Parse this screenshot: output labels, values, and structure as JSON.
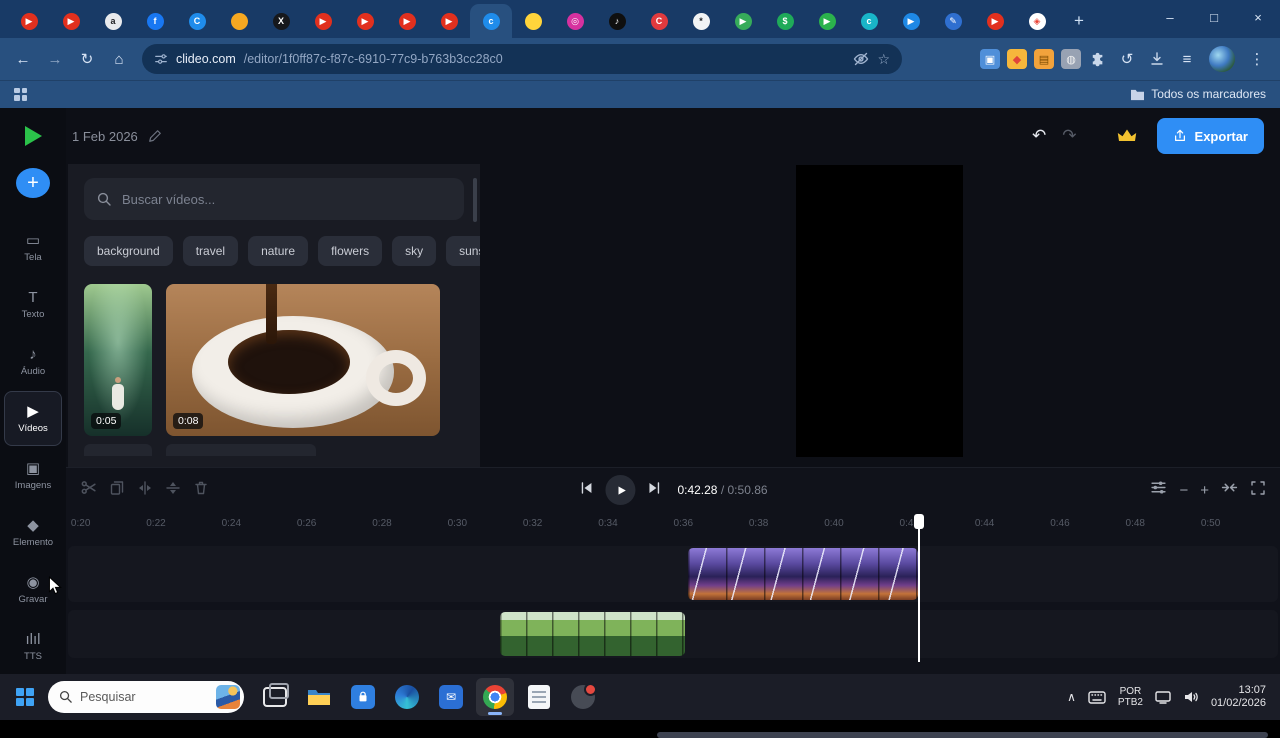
{
  "theme": {
    "accent": "#2f8ef5",
    "crown": "#f2c230",
    "logo-green": "#2bc24a",
    "chrome-bar": "#28507f",
    "chrome-dark": "#183a66",
    "chrome-pill": "#133256",
    "app-bg": "#0d0f16",
    "panel-bg": "#191b23",
    "taskbar-bg": "#1b1d27"
  },
  "icons": {
    "back": "←",
    "forward": "→",
    "reload": "↻",
    "home": "⌂",
    "star": "☆",
    "history": "↺",
    "reading_list": "≡",
    "menu": "⋮",
    "minimize": "–",
    "maximize": "□",
    "close": "×",
    "new_tab": "+",
    "add": "+",
    "undo": "↶",
    "redo": "↷",
    "zoom_out": "−",
    "zoom_in": "+",
    "chevron_up": "∧",
    "envelope": "✉"
  },
  "browser": {
    "tabs": [
      {
        "name": "youtube",
        "bg": "#e1301e",
        "glyph": "▶"
      },
      {
        "name": "youtube",
        "bg": "#e1301e",
        "glyph": "▶"
      },
      {
        "name": "amazon",
        "bg": "#e8eaed",
        "glyph": "a",
        "fg": "#202124"
      },
      {
        "name": "facebook",
        "bg": "#1877f2",
        "glyph": "f"
      },
      {
        "name": "c-app",
        "bg": "#1f8ceb",
        "glyph": "C"
      },
      {
        "name": "orange-app",
        "bg": "#f6a821",
        "glyph": ""
      },
      {
        "name": "x",
        "bg": "#16181c",
        "glyph": "X"
      },
      {
        "name": "youtube",
        "bg": "#e1301e",
        "glyph": "▶"
      },
      {
        "name": "youtube",
        "bg": "#e1301e",
        "glyph": "▶"
      },
      {
        "name": "youtube",
        "bg": "#e1301e",
        "glyph": "▶"
      },
      {
        "name": "youtube",
        "bg": "#e1301e",
        "glyph": "▶"
      },
      {
        "name": "clideo",
        "bg": "#1f8ceb",
        "glyph": "c",
        "active": true
      },
      {
        "name": "yellow-app",
        "bg": "#ffd43b",
        "glyph": "",
        "fg": "#333333"
      },
      {
        "name": "instagram",
        "bg": "#d6319f",
        "glyph": "◎"
      },
      {
        "name": "tiktok",
        "bg": "#0f0f0f",
        "glyph": "♪"
      },
      {
        "name": "red-c-app",
        "bg": "#e03a3e",
        "glyph": "C"
      },
      {
        "name": "white-app",
        "bg": "#f1f3f4",
        "glyph": "*",
        "fg": "#202124"
      },
      {
        "name": "play-app",
        "bg": "#36ab5a",
        "glyph": "▶"
      },
      {
        "name": "dollar-app",
        "bg": "#1faa59",
        "glyph": "$"
      },
      {
        "name": "green-play-app",
        "bg": "#2bb24c",
        "glyph": "▶"
      },
      {
        "name": "teal-c-app",
        "bg": "#19b5c8",
        "glyph": "c"
      },
      {
        "name": "blue-play-app",
        "bg": "#1e88e5",
        "glyph": "▶"
      },
      {
        "name": "pen-app",
        "bg": "#2f6fd0",
        "glyph": "✎"
      },
      {
        "name": "youtube",
        "bg": "#e1301e",
        "glyph": "▶"
      },
      {
        "name": "photos-app",
        "bg": "#ffffff",
        "glyph": "◈",
        "fg": "#ea4335"
      }
    ],
    "address": {
      "host": "clideo.com",
      "path": "/editor/1f0ff87c-f87c-6910-77c9-b763b3cc28c0"
    },
    "ext_icons": [
      {
        "name": "image-extension",
        "bg": "#4f8fd9",
        "glyph": "▣"
      },
      {
        "name": "colorful-extension",
        "bg": "#f6b73c",
        "glyph": "◆",
        "fg": "#e0453a"
      },
      {
        "name": "folder-extension",
        "bg": "#f2a33c",
        "glyph": "▤",
        "fg": "#7a4a00"
      },
      {
        "name": "globe-extension",
        "bg": "#98a2b3",
        "glyph": "◍",
        "fg": "#f0f0f0"
      }
    ],
    "bookmarks": {
      "all_label": "Todos os marcadores"
    }
  },
  "editor": {
    "date": "1 Feb 2026",
    "export_label": "Exportar",
    "sidebar": [
      {
        "name": "tela",
        "glyph": "▭",
        "label": "Tela"
      },
      {
        "name": "texto",
        "glyph": "T",
        "label": "Texto"
      },
      {
        "name": "audio",
        "glyph": "♪",
        "label": "Áudio"
      },
      {
        "name": "videos",
        "glyph": "▶",
        "label": "Vídeos",
        "active": true
      },
      {
        "name": "imagens",
        "glyph": "▣",
        "label": "Imagens"
      },
      {
        "name": "elemento",
        "glyph": "◆",
        "label": "Elemento"
      },
      {
        "name": "gravar",
        "glyph": "◉",
        "label": "Gravar"
      },
      {
        "name": "tts",
        "glyph": "ılıl",
        "label": "TTS"
      }
    ],
    "search_placeholder": "Buscar vídeos...",
    "chips": [
      "background",
      "travel",
      "nature",
      "flowers",
      "sky",
      "sunset"
    ],
    "videos": [
      {
        "duration": "0:05"
      },
      {
        "duration": "0:08"
      }
    ],
    "transport": {
      "current": "0:42.28",
      "separator": " / ",
      "total": "0:50.86"
    },
    "ruler": [
      "0:20",
      "0:22",
      "0:24",
      "0:26",
      "0:28",
      "0:30",
      "0:32",
      "0:34",
      "0:36",
      "0:38",
      "0:40",
      "0:42",
      "0:44",
      "0:46",
      "0:48",
      "0:50"
    ]
  },
  "taskbar": {
    "search_placeholder": "Pesquisar",
    "language": {
      "line1": "POR",
      "line2": "PTB2"
    },
    "clock": {
      "time": "13:07",
      "date": "01/02/2026"
    }
  }
}
